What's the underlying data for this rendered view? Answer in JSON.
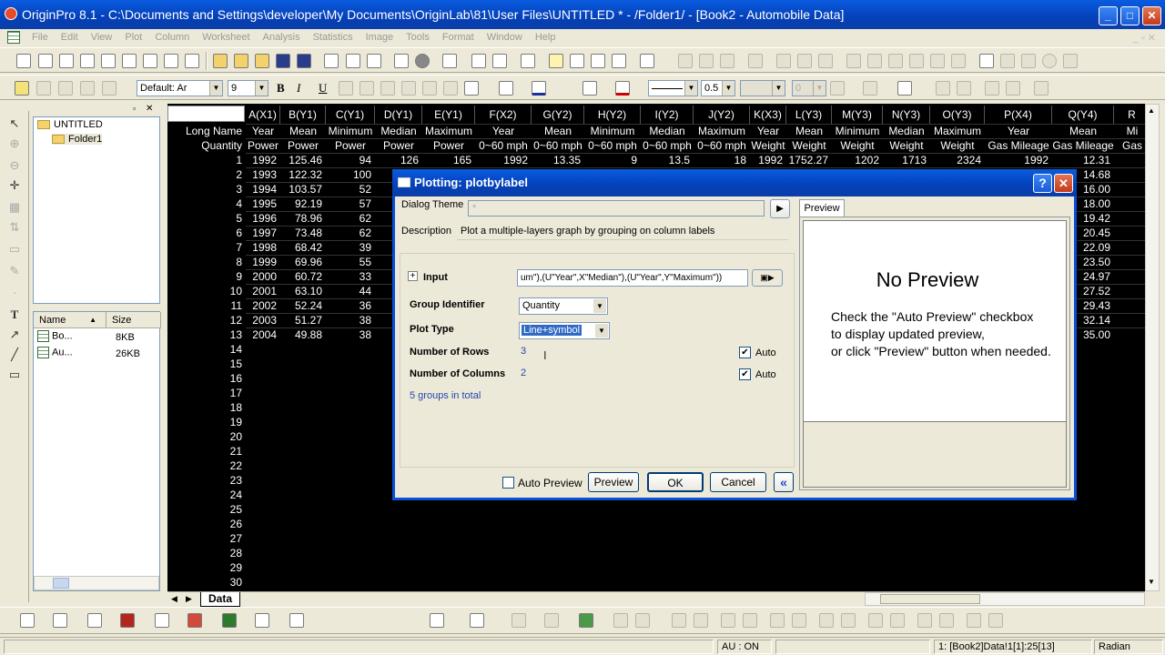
{
  "window": {
    "title": "OriginPro 8.1 - C:\\Documents and Settings\\developer\\My Documents\\OriginLab\\81\\User Files\\UNTITLED * - /Folder1/ - [Book2 - Automobile Data]",
    "min": "_",
    "max": "□",
    "close": "✕"
  },
  "menu": [
    "File",
    "Edit",
    "View",
    "Plot",
    "Column",
    "Worksheet",
    "Analysis",
    "Statistics",
    "Image",
    "Tools",
    "Format",
    "Window",
    "Help"
  ],
  "format_toolbar": {
    "font": "Default: Ar",
    "size": "9",
    "bold": "B",
    "italic": "I",
    "underline": "U",
    "line_width": "0.5",
    "zero": "0"
  },
  "explorer": {
    "root": "UNTITLED",
    "child": "Folder1"
  },
  "files": {
    "headers": [
      "Name",
      "Size"
    ],
    "rows": [
      {
        "name": "Bo...",
        "size": "8KB"
      },
      {
        "name": "Au...",
        "size": "26KB"
      }
    ]
  },
  "sheet": {
    "columns": [
      "A(X1)",
      "B(Y1)",
      "C(Y1)",
      "D(Y1)",
      "E(Y1)",
      "F(X2)",
      "G(Y2)",
      "H(Y2)",
      "I(Y2)",
      "J(Y2)",
      "K(X3)",
      "L(Y3)",
      "M(Y3)",
      "N(Y3)",
      "O(Y3)",
      "P(X4)",
      "Q(Y4)",
      "R"
    ],
    "row_labels": [
      "Long Name",
      "Quantity"
    ],
    "long_names": [
      "Year",
      "Mean",
      "Minimum",
      "Median",
      "Maximum",
      "Year",
      "Mean",
      "Minimum",
      "Median",
      "Maximum",
      "Year",
      "Mean",
      "Minimum",
      "Median",
      "Maximum",
      "Year",
      "Mean",
      "Mi"
    ],
    "quantities": [
      "Power",
      "Power",
      "Power",
      "Power",
      "Power",
      "0~60 mph",
      "0~60 mph",
      "0~60 mph",
      "0~60 mph",
      "0~60 mph",
      "Weight",
      "Weight",
      "Weight",
      "Weight",
      "Weight",
      "Gas Mileage",
      "Gas Mileage",
      "Gas"
    ],
    "row1": [
      "1992",
      "125.46",
      "94",
      "126",
      "165",
      "1992",
      "13.35",
      "9",
      "13.5",
      "18",
      "1992",
      "1752.27",
      "1202",
      "1713",
      "2324",
      "1992",
      "12.31"
    ],
    "colA": [
      "1992",
      "1993",
      "1994",
      "1995",
      "1996",
      "1997",
      "1998",
      "1999",
      "2000",
      "2001",
      "2002",
      "2003",
      "2004"
    ],
    "colB": [
      "125.46",
      "122.32",
      "103.57",
      "92.19",
      "78.96",
      "73.48",
      "68.42",
      "69.96",
      "60.72",
      "63.10",
      "52.24",
      "51.27",
      "49.88"
    ],
    "colC": [
      "94",
      "100",
      "52",
      "57",
      "62",
      "62",
      "39",
      "55",
      "33",
      "44",
      "36",
      "38",
      "38"
    ],
    "colQ": [
      "12.31",
      "14.68",
      "16.00",
      "18.00",
      "19.42",
      "20.45",
      "22.09",
      "23.50",
      "24.97",
      "27.52",
      "29.43",
      "32.14",
      "35.00"
    ],
    "tab": "Data"
  },
  "dialog": {
    "title": "Plotting: plotbylabel",
    "help": "?",
    "theme_label": "Dialog Theme",
    "theme_value": "*",
    "description_label": "Description",
    "description": "Plot a multiple-layers graph by grouping on column labels",
    "preview_tab": "Preview",
    "input_label": "Input",
    "input_value": "um\"),(U\"Year\",X\"Median\"),(U\"Year\",Y\"Maximum\"))",
    "group_label": "Group Identifier",
    "group_value": "Quantity",
    "plottype_label": "Plot Type",
    "plottype_value": "Line+symbol",
    "rows_label": "Number of Rows",
    "rows_value": "3",
    "cols_label": "Number of Columns",
    "cols_value": "2",
    "auto": "Auto",
    "groups": "5 groups in total",
    "no_preview": "No Preview",
    "preview_hint1": "Check the \"Auto Preview\" checkbox",
    "preview_hint2": "to display updated preview,",
    "preview_hint3": "or click \"Preview\" button when needed.",
    "auto_preview": "Auto Preview",
    "preview_btn": "Preview",
    "ok": "OK",
    "cancel": "Cancel",
    "collapse": "«"
  },
  "status": {
    "au": "AU : ON",
    "cell": "1: [Book2]Data!1[1]:25[13]",
    "angle": "Radian"
  }
}
